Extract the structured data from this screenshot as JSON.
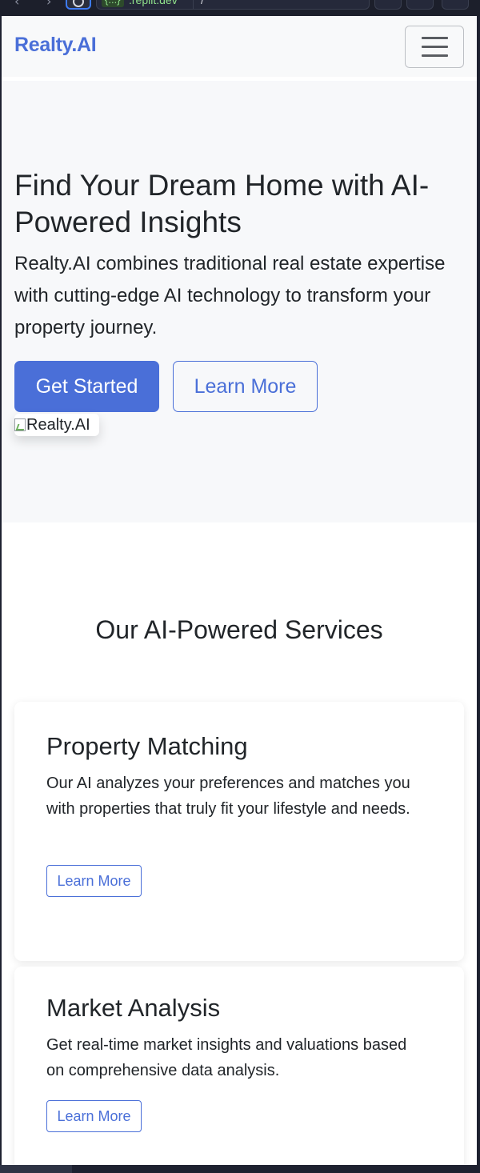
{
  "browser": {
    "url_tag": "{...}",
    "url_host": ".replit.dev",
    "url_path": "/"
  },
  "navbar": {
    "brand": "Realty.AI"
  },
  "hero": {
    "title": "Find Your Dream Home with AI-Powered Insights",
    "lead": "Realty.AI combines traditional real estate expertise with cutting-edge AI technology to transform your property journey.",
    "primary_button": "Get Started",
    "secondary_button": "Learn More",
    "image_alt": "Realty.AI"
  },
  "services": {
    "title": "Our AI-Powered Services",
    "cards": [
      {
        "title": "Property Matching",
        "text": "Our AI analyzes your preferences and matches you with properties that truly fit your lifestyle and needs.",
        "button": "Learn More"
      },
      {
        "title": "Market Analysis",
        "text": "Get real-time market insights and valuations based on comprehensive data analysis.",
        "button": "Learn More"
      }
    ]
  },
  "colors": {
    "accent": "#4a6fd8",
    "hero_bg": "#f7f8fa",
    "navbar_bg": "#f8f9fa",
    "chrome_bg": "#1e2130",
    "url_green": "#8fe08a"
  }
}
